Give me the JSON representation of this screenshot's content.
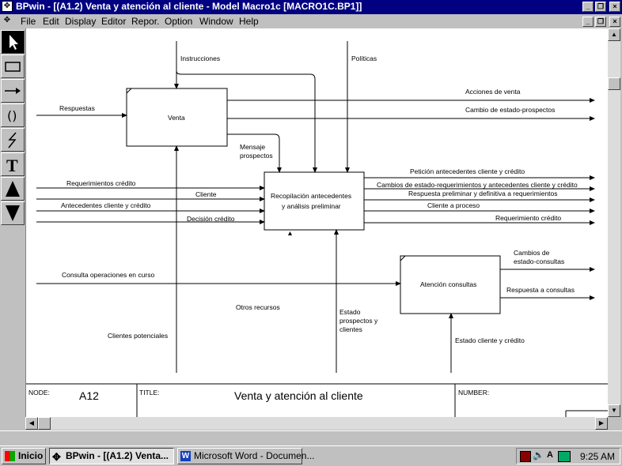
{
  "window": {
    "title": "BPwin - [(A1.2) Venta y atención al cliente - Model Macro1c  [MACRO1C.BP1]]"
  },
  "menu": [
    "File",
    "Edit",
    "Display",
    "Editor",
    "Repor.",
    "Option",
    "Window",
    "Help"
  ],
  "toolbox": {
    "tools": [
      "pointer-icon",
      "box-icon",
      "arrow-icon",
      "parenthesis-icon",
      "squiggle-icon",
      "text-icon",
      "up-arrow-icon",
      "down-arrow-icon"
    ]
  },
  "diagram": {
    "boxes": {
      "venta": "Venta",
      "recopilacion_l1": "Recopilación antecedentes",
      "recopilacion_l2": "y análisis preliminar",
      "atencion": "Atención consultas"
    },
    "arrow_labels": {
      "instrucciones": "Instrucciones",
      "politicas": "Políticas",
      "respuestas": "Respuestas",
      "acciones_venta": "Acciones de venta",
      "cambio_estado_prospectos": "Cambio de estado-prospectos",
      "mensaje_l1": "Mensaje",
      "mensaje_l2": "prospectos",
      "peticion": "Petición antecedentes cliente y crédito",
      "requerimientos_credito": "Requerimientos crédito",
      "cambios_estado_req": "Cambios de estado-requerimientos y antecedentes cliente y crédito",
      "cliente": "Cliente",
      "respuesta_preliminar": "Respuesta preliminar y definitiva a requerimientos",
      "antecedentes": "Antecedentes cliente y crédito",
      "cliente_proceso": "Cliente a proceso",
      "decision_credito": "Decisión crédito",
      "requerimiento_credito": "Requerimiento crédito",
      "cambios_consultas_l1": "Cambios de",
      "cambios_consultas_l2": "estado-consultas",
      "consulta_operaciones": "Consulta operaciones en curso",
      "respuesta_consultas": "Respuesta a consultas",
      "otros_recursos": "Otros recursos",
      "estado_l1": "Estado",
      "estado_l2": "prospectos y",
      "estado_l3": "clientes",
      "clientes_potenciales": "Clientes potenciales",
      "estado_cliente_credito": "Estado cliente y crédito"
    },
    "footer": {
      "node_label": "NODE:",
      "node_value": "A12",
      "title_label": "TITLE:",
      "title_value": "Venta y atención al cliente",
      "number_label": "NUMBER:"
    }
  },
  "taskbar": {
    "start": "Inicio",
    "tasks": [
      "BPwin - [(A1.2) Venta...",
      "Microsoft Word - Documen..."
    ],
    "clock": "9:25 AM"
  }
}
